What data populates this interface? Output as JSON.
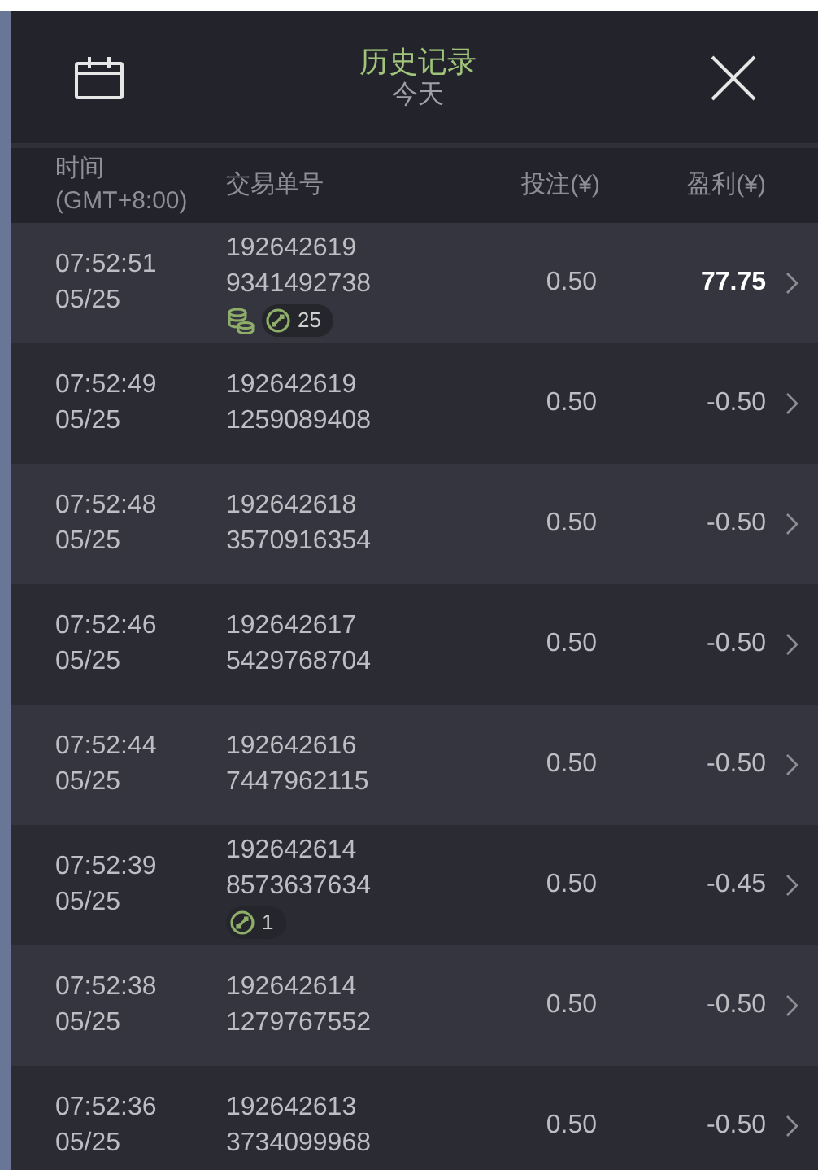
{
  "header": {
    "title": "历史记录",
    "subtitle": "今天"
  },
  "columns": [
    "时间\n(GMT+8:00)",
    "交易单号",
    "投注(¥)",
    "盈利(¥)"
  ],
  "rows": [
    {
      "time": "07:52:51",
      "date": "05/25",
      "id_1": "192642619",
      "id_2": "9341492738",
      "stake": "0.50",
      "profit": "77.75",
      "win": true,
      "coins": true,
      "spins": "25"
    },
    {
      "time": "07:52:49",
      "date": "05/25",
      "id_1": "192642619",
      "id_2": "1259089408",
      "stake": "0.50",
      "profit": "-0.50",
      "win": false,
      "coins": false
    },
    {
      "time": "07:52:48",
      "date": "05/25",
      "id_1": "192642618",
      "id_2": "3570916354",
      "stake": "0.50",
      "profit": "-0.50",
      "win": false,
      "coins": false
    },
    {
      "time": "07:52:46",
      "date": "05/25",
      "id_1": "192642617",
      "id_2": "5429768704",
      "stake": "0.50",
      "profit": "-0.50",
      "win": false,
      "coins": false
    },
    {
      "time": "07:52:44",
      "date": "05/25",
      "id_1": "192642616",
      "id_2": "7447962115",
      "stake": "0.50",
      "profit": "-0.50",
      "win": false,
      "coins": false
    },
    {
      "time": "07:52:39",
      "date": "05/25",
      "id_1": "192642614",
      "id_2": "8573637634",
      "stake": "0.50",
      "profit": "-0.45",
      "win": false,
      "coins": false,
      "spins": "1"
    },
    {
      "time": "07:52:38",
      "date": "05/25",
      "id_1": "192642614",
      "id_2": "1279767552",
      "stake": "0.50",
      "profit": "-0.50",
      "win": false,
      "coins": false
    },
    {
      "time": "07:52:36",
      "date": "05/25",
      "id_1": "192642613",
      "id_2": "3734099968",
      "stake": "0.50",
      "profit": "-0.50",
      "win": false,
      "coins": false
    }
  ]
}
